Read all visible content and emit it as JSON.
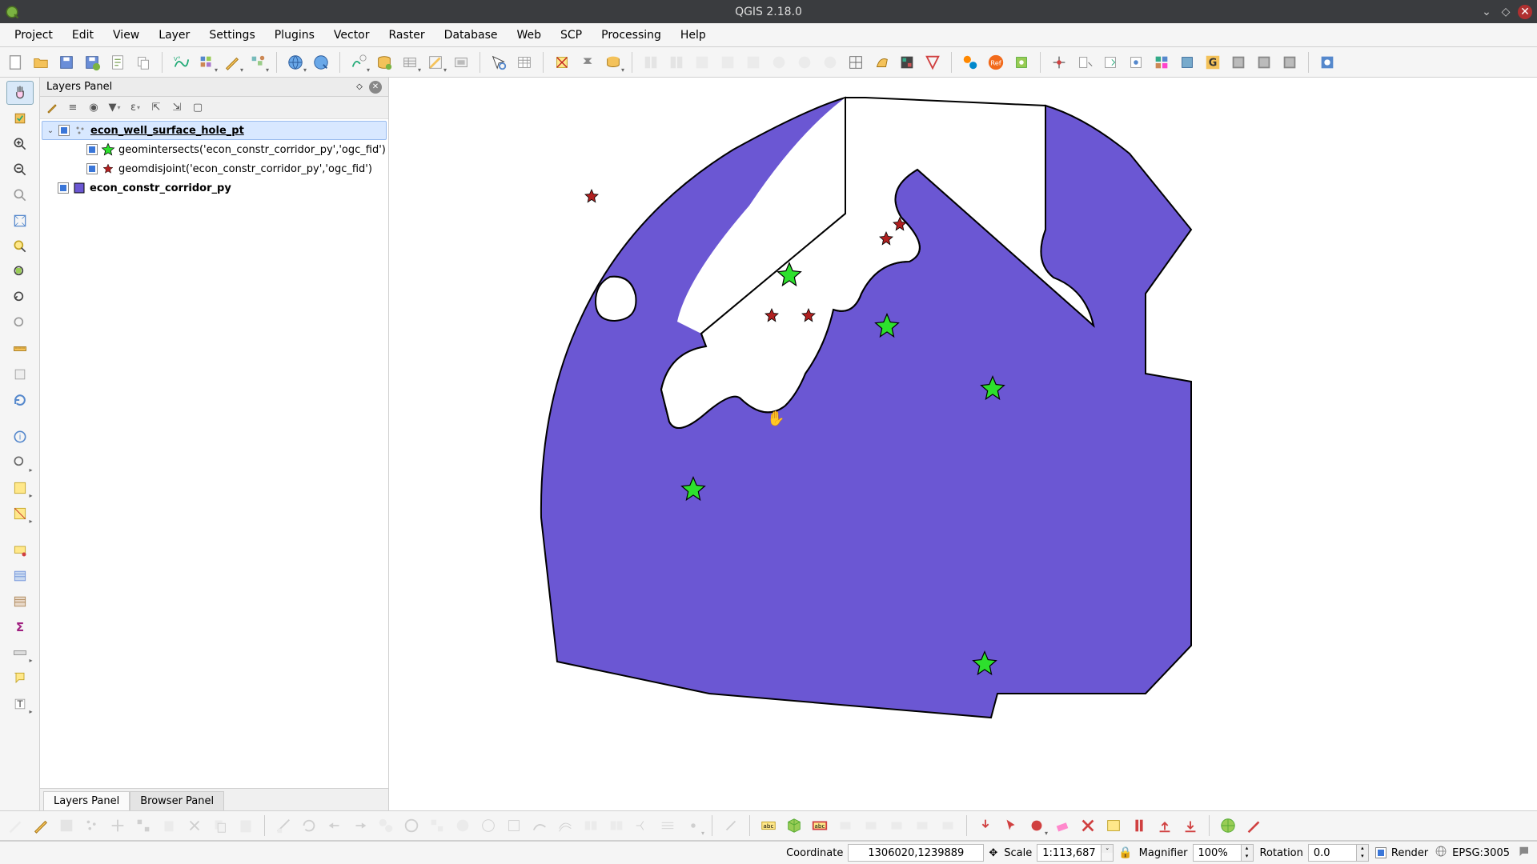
{
  "titlebar": {
    "title": "QGIS 2.18.0"
  },
  "menu": [
    "Project",
    "Edit",
    "View",
    "Layer",
    "Settings",
    "Plugins",
    "Vector",
    "Raster",
    "Database",
    "Web",
    "SCP",
    "Processing",
    "Help"
  ],
  "panel": {
    "title": "Layers Panel",
    "tabs": {
      "t1": "Layers Panel",
      "t2": "Browser Panel"
    }
  },
  "layers": {
    "root": {
      "name": "econ_well_surface_hole_pt",
      "rule1": "geomintersects('econ_constr_corridor_py','ogc_fid')",
      "rule2": "geomdisjoint('econ_constr_corridor_py','ogc_fid')"
    },
    "poly": {
      "name": "econ_constr_corridor_py"
    }
  },
  "status": {
    "coord_label": "Coordinate",
    "coord_value": "1306020,1239889",
    "scale_label": "Scale",
    "scale_value": "1:113,687",
    "mag_label": "Magnifier",
    "mag_value": "100%",
    "rot_label": "Rotation",
    "rot_value": "0.0",
    "render_label": "Render",
    "crs_label": "EPSG:3005"
  }
}
